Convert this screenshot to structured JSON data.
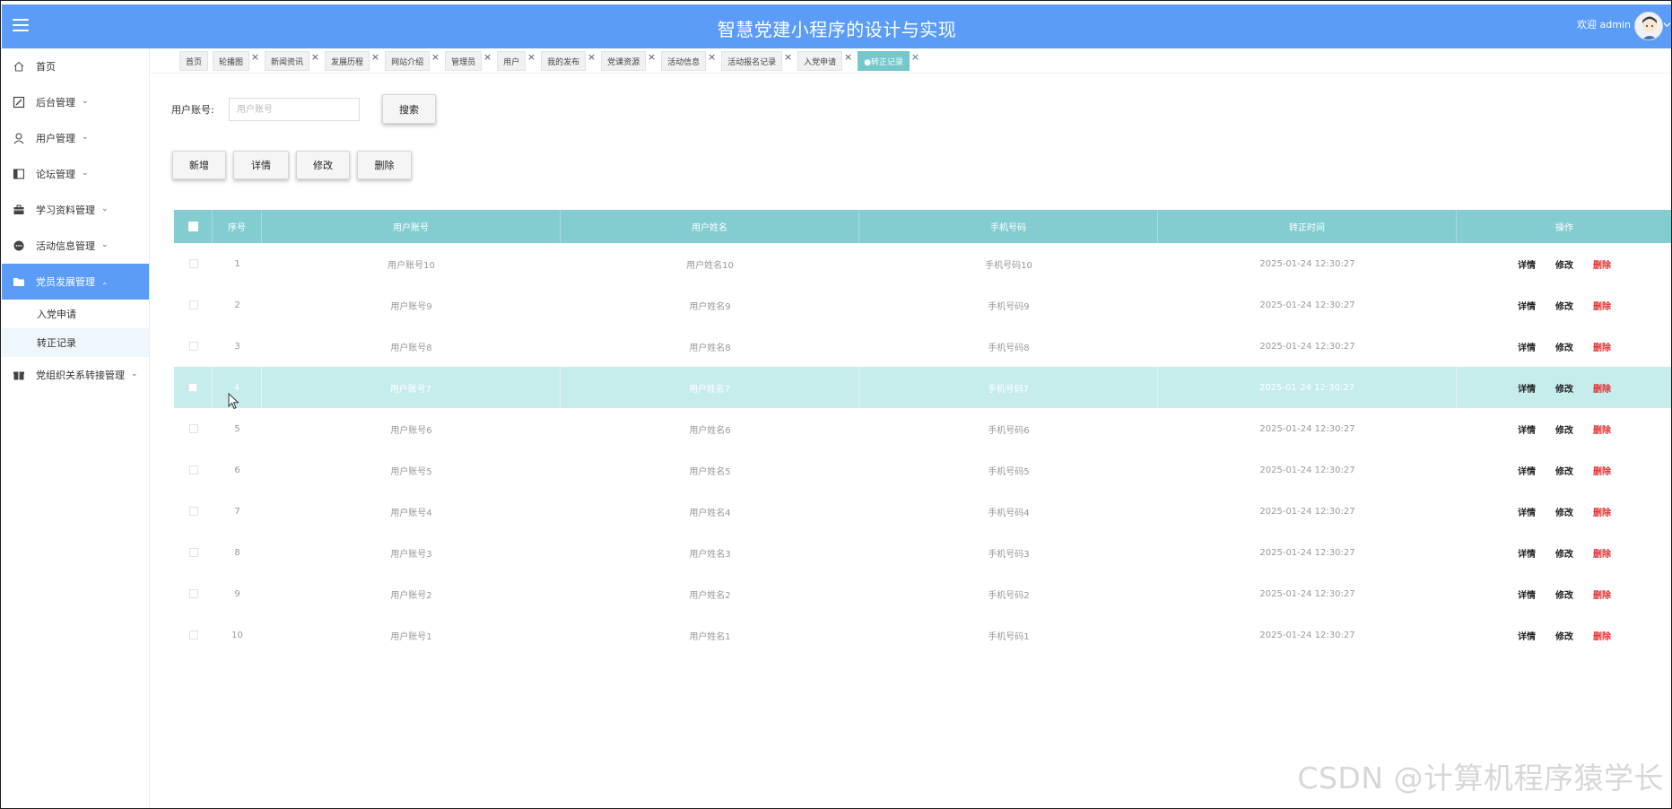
{
  "header": {
    "title": "智慧党建小程序的设计与实现",
    "welcome": "欢迎 admin"
  },
  "sidebar": {
    "items": [
      {
        "label": "首页",
        "icon": "home-icon"
      },
      {
        "label": "后台管理",
        "icon": "edit-box-icon"
      },
      {
        "label": "用户管理",
        "icon": "user-icon"
      },
      {
        "label": "论坛管理",
        "icon": "forum-icon"
      },
      {
        "label": "学习资料管理",
        "icon": "briefcase-icon"
      },
      {
        "label": "活动信息管理",
        "icon": "chat-dots-icon"
      },
      {
        "label": "党员发展管理",
        "icon": "folder-icon"
      },
      {
        "label": "党组织关系转接管理",
        "icon": "gift-icon"
      }
    ],
    "sub_items": [
      {
        "label": "入党申请"
      },
      {
        "label": "转正记录"
      }
    ]
  },
  "tabs": [
    {
      "label": "首页"
    },
    {
      "label": "轮播图"
    },
    {
      "label": "新闻资讯"
    },
    {
      "label": "发展历程"
    },
    {
      "label": "网站介绍"
    },
    {
      "label": "管理员"
    },
    {
      "label": "用户"
    },
    {
      "label": "我的发布"
    },
    {
      "label": "党课资源"
    },
    {
      "label": "活动信息"
    },
    {
      "label": "活动报名记录"
    },
    {
      "label": "入党申请"
    },
    {
      "label": "●转正记录"
    }
  ],
  "tab_close": "×",
  "search": {
    "label": "用户账号:",
    "placeholder": "用户账号",
    "button": "搜索"
  },
  "toolbar": {
    "add": "新增",
    "detail": "详情",
    "edit": "修改",
    "delete": "删除"
  },
  "table": {
    "columns": [
      "序号",
      "用户账号",
      "用户姓名",
      "手机号码",
      "转正时间",
      "操作"
    ],
    "rows": [
      {
        "idx": "1",
        "account": "用户账号10",
        "name": "用户姓名10",
        "phone": "手机号码10",
        "time": "2025-01-24 12:30:27"
      },
      {
        "idx": "2",
        "account": "用户账号9",
        "name": "用户姓名9",
        "phone": "手机号码9",
        "time": "2025-01-24 12:30:27"
      },
      {
        "idx": "3",
        "account": "用户账号8",
        "name": "用户姓名8",
        "phone": "手机号码8",
        "time": "2025-01-24 12:30:27"
      },
      {
        "idx": "4",
        "account": "用户账号7",
        "name": "用户姓名7",
        "phone": "手机号码7",
        "time": "2025-01-24 12:30:27"
      },
      {
        "idx": "5",
        "account": "用户账号6",
        "name": "用户姓名6",
        "phone": "手机号码6",
        "time": "2025-01-24 12:30:27"
      },
      {
        "idx": "6",
        "account": "用户账号5",
        "name": "用户姓名5",
        "phone": "手机号码5",
        "time": "2025-01-24 12:30:27"
      },
      {
        "idx": "7",
        "account": "用户账号4",
        "name": "用户姓名4",
        "phone": "手机号码4",
        "time": "2025-01-24 12:30:27"
      },
      {
        "idx": "8",
        "account": "用户账号3",
        "name": "用户姓名3",
        "phone": "手机号码3",
        "time": "2025-01-24 12:30:27"
      },
      {
        "idx": "9",
        "account": "用户账号2",
        "name": "用户姓名2",
        "phone": "手机号码2",
        "time": "2025-01-24 12:30:27"
      },
      {
        "idx": "10",
        "account": "用户账号1",
        "name": "用户姓名1",
        "phone": "手机号码1",
        "time": "2025-01-24 12:30:27"
      }
    ],
    "ops": {
      "detail": "详情",
      "edit": "修改",
      "delete": "删除"
    }
  },
  "watermark": "CSDN @计算机程序猿学长",
  "colors": {
    "header_bg": "#5a9cf8",
    "active_menu": "#5a9cf8",
    "table_head": "#83cdd1",
    "active_tab": "#74c7cb",
    "hover_row": "#c7ecec",
    "delete_text": "#e03030"
  }
}
